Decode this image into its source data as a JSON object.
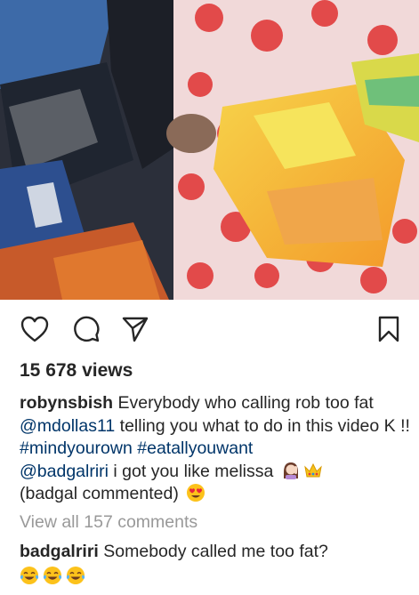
{
  "post": {
    "views": "15 678 views",
    "caption": {
      "username": "robynsbish",
      "text_1": " Everybody who calling rob too fat ",
      "mention_1": "@mdollas11",
      "text_2": " telling you what to do in this video K !! ",
      "hashtag_1": "#mindyourown",
      "hashtag_2": "#eatallyouwant",
      "mention_2": "@badgalriri",
      "text_3": " i got you like melissa",
      "text_4": "(badgal commented)"
    },
    "view_all_comments": "View all 157 comments",
    "comment": {
      "username": "badgalriri",
      "text": " Somebody called me too fat?"
    }
  },
  "icons": {
    "like": "heart-icon",
    "comment": "comment-bubble-icon",
    "share": "paper-plane-icon",
    "save": "bookmark-icon"
  },
  "colors": {
    "text": "#262626",
    "link": "#003569",
    "muted": "#999999"
  }
}
